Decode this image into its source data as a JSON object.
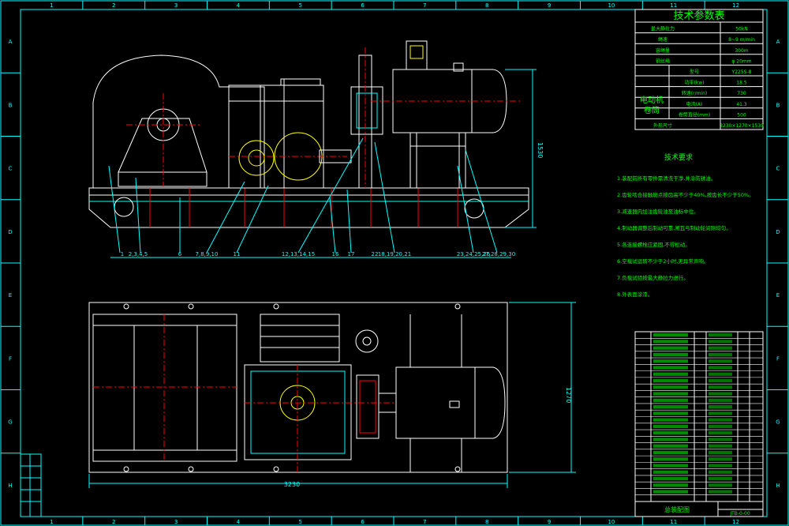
{
  "title_block": {
    "params_title": "技术参数表",
    "motor_label": "电动机",
    "reducer_label": "卷筒",
    "tech_req_title": "技术要求",
    "drawing_name": "总装配图",
    "drawing_code": "JTB-0-00"
  },
  "param_rows": [
    {
      "name": "最大静拉力",
      "value": "50kN"
    },
    {
      "name": "绳速",
      "value": "8~9 m/min"
    },
    {
      "name": "容绳量",
      "value": "300m"
    },
    {
      "name": "钢丝绳",
      "value": "φ 20mm"
    },
    {
      "name": "型号",
      "value": "Y225S-8"
    },
    {
      "name": "功率(kw)",
      "value": "18.5"
    },
    {
      "name": "转速(r/min)",
      "value": "730"
    },
    {
      "name": "电流(A)",
      "value": "41.3"
    },
    {
      "name": "卷筒直径(mm)",
      "value": "500"
    },
    {
      "name": "外形尺寸",
      "value": "3230×1270×1530"
    }
  ],
  "tech_requirements": [
    "1.装配前所有零件需清洗干净,并涂防锈油。",
    "2.齿轮啮合接触斑点按齿高不少于40%,按齿长不少于50%。",
    "3.减速器内加注齿轮油至油标中位。",
    "4.制动器调整后制动可靠,闸瓦与制动轮间隙均匀。",
    "5.各连接螺栓应紧固,不得松动。",
    "6.空载试运转不少于2小时,无异常声响。",
    "7.负载试验按最大静拉力进行。",
    "8.外表面涂漆。"
  ],
  "callouts_top": [
    "1",
    "2,3,4,5",
    "6",
    "7,8,9,10",
    "11",
    "12,13,14,15",
    "16",
    "17",
    "18,19,20,21",
    "22",
    "23,24,25,26",
    "27,28,29,30"
  ],
  "dimensions": {
    "total_length": "3230",
    "total_width": "1270",
    "total_height": "1530"
  },
  "frame_top_numbers": [
    "1",
    "2",
    "3",
    "4",
    "5",
    "6",
    "7",
    "8",
    "9",
    "10",
    "11",
    "12"
  ],
  "frame_side_letters": [
    "A",
    "B",
    "C",
    "D",
    "E",
    "F",
    "G",
    "H"
  ],
  "colors": {
    "background": "#000000",
    "line": "#ffffff",
    "green": "#00ff00",
    "cyan": "#00ffff",
    "red": "#ff0000",
    "yellow": "#ffff00",
    "blue": "#4a6cff"
  }
}
